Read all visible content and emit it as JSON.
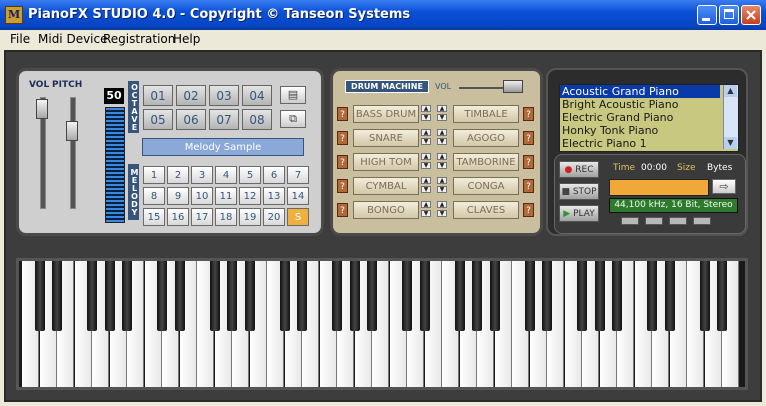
{
  "window": {
    "title": "PianoFX STUDIO 4.0 - Copyright © Tanseon Systems",
    "icon_letter": "M"
  },
  "menu": [
    "File",
    "Midi Device",
    "Registration",
    "Help"
  ],
  "left": {
    "vol_label": "VOL",
    "pitch_label": "PITCH",
    "octave_label": "OCTAVE",
    "melody_label": "MELODY",
    "level_value": "50",
    "octave_buttons": [
      "01",
      "02",
      "03",
      "04",
      "05",
      "06",
      "07",
      "08"
    ],
    "melody_display": "Melody Sample",
    "melody_buttons": [
      "1",
      "2",
      "3",
      "4",
      "5",
      "6",
      "7",
      "8",
      "9",
      "10",
      "11",
      "12",
      "13",
      "14",
      "15",
      "16",
      "17",
      "18",
      "19",
      "20",
      "S"
    ]
  },
  "drum": {
    "title": "DRUM MACHINE",
    "vol_label": "VOL",
    "q": "?",
    "left": [
      "BASS DRUM",
      "SNARE",
      "HIGH TOM",
      "CYMBAL",
      "BONGO"
    ],
    "right": [
      "TIMBALE",
      "AGOGO",
      "TAMBORINE",
      "CONGA",
      "CLAVES"
    ]
  },
  "voices": [
    "Acoustic Grand Piano",
    "Bright Acoustic Piano",
    "Electric Grand Piano",
    "Honky Tonk Piano",
    "Electric Piano 1"
  ],
  "recorder": {
    "rec": "REC",
    "stop": "STOP",
    "play": "PLAY",
    "time_label": "Time",
    "time_value": "00:00",
    "size_label": "Size",
    "size_value": "Bytes",
    "format": "44,100 kHz, 16 Bit, Stereo"
  },
  "icons": [
    "menu-icon",
    "copy-icon",
    "open-icon",
    "record-icon",
    "stop-icon",
    "play-icon"
  ]
}
